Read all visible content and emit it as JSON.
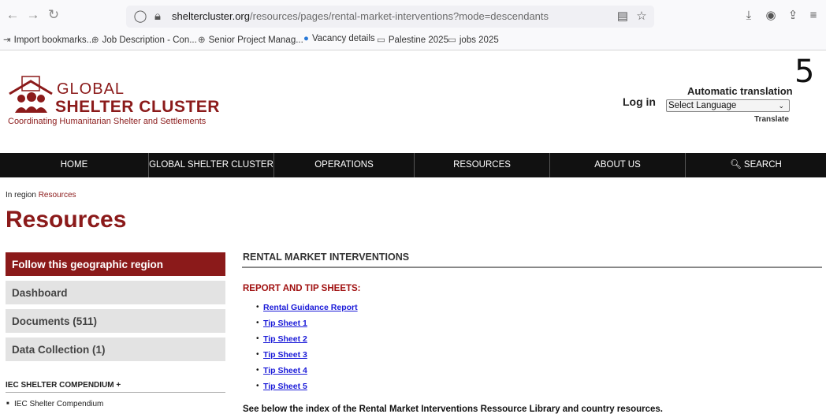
{
  "browser": {
    "url_prefix": "sheltercluster.org",
    "url_path": "/resources/pages/rental-market-interventions?mode=descendants",
    "bookmarks": [
      "Import bookmarks...",
      "Job Description - Con...",
      "Senior Project Manag...",
      "Vacancy details",
      "Palestine 2025",
      "jobs 2025"
    ]
  },
  "header": {
    "logo_line1": "GLOBAL",
    "logo_line2": "SHELTER CLUSTER",
    "tagline": "Coordinating Humanitarian Shelter and Settlements",
    "page_number": "5",
    "login": "Log in",
    "auto_translation": "Automatic translation",
    "language_selected": "Select Language",
    "translate": "Translate"
  },
  "nav": {
    "items": [
      "HOME",
      "GLOBAL SHELTER CLUSTER",
      "OPERATIONS",
      "RESOURCES",
      "ABOUT US",
      "SEARCH"
    ]
  },
  "breadcrumb": {
    "prefix": "In region",
    "link": "Resources"
  },
  "page_title": "Resources",
  "sidebar": {
    "follow": "Follow this geographic region",
    "items": [
      "Dashboard",
      "Documents (511)",
      "Data Collection (1)"
    ],
    "iec_heading": "IEC SHELTER COMPENDIUM +",
    "iec_item": "IEC Shelter Compendium"
  },
  "main": {
    "heading": "RENTAL MARKET INTERVENTIONS",
    "report_heading": "REPORT AND TIP SHEETS:",
    "links": [
      "Rental Guidance Report",
      "Tip Sheet 1",
      "Tip Sheet 2",
      "Tip Sheet 3",
      "Tip Sheet 4",
      "Tip Sheet 5"
    ],
    "index_text": "See below the index of the Rental Market Interventions Ressource Library and country resources."
  },
  "colors": {
    "brand": "#8b1a1a",
    "link": "#1a1ad8",
    "nav_bg": "#111111"
  }
}
